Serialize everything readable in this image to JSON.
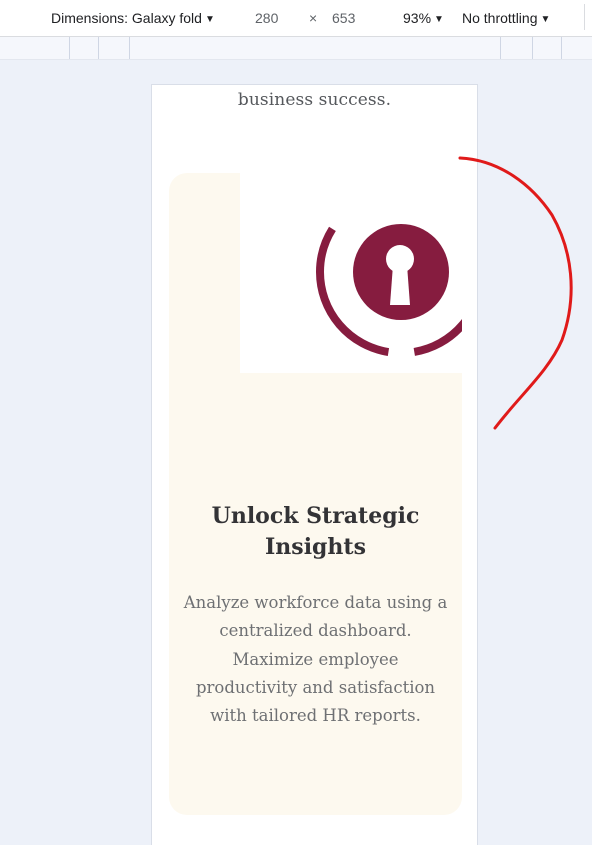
{
  "devtools": {
    "dimensions_label": "Dimensions: Galaxy fold",
    "width_value": "280",
    "times_sign": "×",
    "height_value": "653",
    "zoom_label": "93%",
    "throttling_label": "No throttling"
  },
  "page": {
    "intro_tail": "business success.",
    "card": {
      "title": "Unlock Strategic Insights",
      "description": "Analyze workforce data using a centralized dashboard. Maximize employee productivity and satisfaction with tailored HR reports."
    }
  },
  "colors": {
    "brand": "#861c3f",
    "card_background": "#fdf9ef",
    "annotation": "#e01a1a"
  },
  "icons": {
    "dropdown": "caret-down-icon",
    "illustration": "keyhole-lock-icon"
  }
}
